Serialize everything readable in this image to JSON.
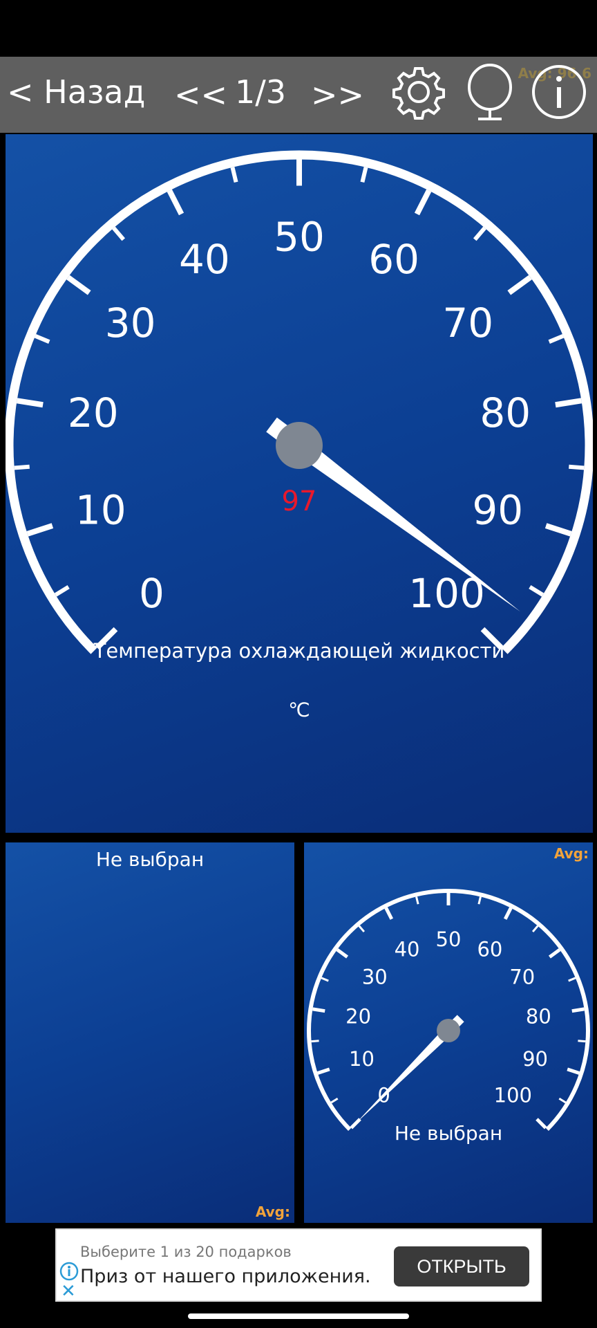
{
  "toolbar": {
    "back_label": "< Назад",
    "prev_label": "<<",
    "page_indicator": "1/3",
    "next_label": ">>",
    "avg_label": "Avg: 96.6"
  },
  "icons": {
    "settings": "gear-icon",
    "voice": "microphone-icon",
    "info": "info-icon"
  },
  "main_gauge": {
    "ticks": [
      "0",
      "10",
      "20",
      "30",
      "40",
      "50",
      "60",
      "70",
      "80",
      "90",
      "100"
    ],
    "value": 97,
    "value_text": "97",
    "title": "Температура охлаждающей жидкости",
    "unit": "℃",
    "value_color": "#e8192c"
  },
  "left_panel": {
    "title": "Не выбран",
    "avg_label": "Avg:"
  },
  "right_panel": {
    "avg_label": "Avg:",
    "ticks": [
      "0",
      "10",
      "20",
      "30",
      "40",
      "50",
      "60",
      "70",
      "80",
      "90",
      "100"
    ],
    "value": 0,
    "title": "Не выбран"
  },
  "ad": {
    "title": "Выберите 1 из 20 подарков",
    "text": "Приз от нашего приложения.",
    "button": "ОТКРЫТЬ"
  },
  "colors": {
    "panel": "#0f4a9e",
    "toolbar": "#5f5f5f",
    "avg": "#f2a33a",
    "needle_hub": "#7f8792"
  }
}
